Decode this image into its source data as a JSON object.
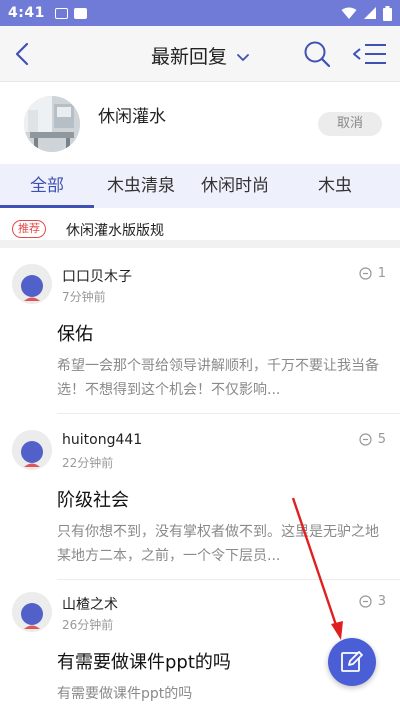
{
  "status_bar": {
    "time": "4:41"
  },
  "header": {
    "title": "最新回复"
  },
  "forum": {
    "name": "休闲灌水",
    "cancel_label": "取消"
  },
  "tabs": [
    {
      "label": "全部",
      "active": true
    },
    {
      "label": "木虫清泉",
      "active": false
    },
    {
      "label": "休闲时尚",
      "active": false
    },
    {
      "label": "木虫",
      "active": false
    }
  ],
  "notice": {
    "badge": "推荐",
    "text": "休闲灌水版版规"
  },
  "posts": [
    {
      "author": "口口贝木子",
      "time": "7分钟前",
      "replies": "1",
      "title": "保佑",
      "excerpt": "希望一会那个哥给领导讲解顺利，千万不要让我当备选！不想得到这个机会！不仅影响..."
    },
    {
      "author": "huitong441",
      "time": "22分钟前",
      "replies": "5",
      "title": "阶级社会",
      "excerpt": "只有你想不到，没有掌权者做不到。这里是无驴之地某地方二本，之前，一个令下层员..."
    },
    {
      "author": "山楂之术",
      "time": "26分钟前",
      "replies": "3",
      "title": "有需要做课件ppt的吗",
      "excerpt": "有需要做课件ppt的吗"
    }
  ],
  "colors": {
    "status_bar": "#6f7bd6",
    "accent": "#3f51b5",
    "fab": "#4a5fd6",
    "avatar": "#5261c9",
    "arrow": "#e02020"
  },
  "icons": {
    "back": "chevron-left-icon",
    "search": "search-icon",
    "menu": "sidebar-menu-icon",
    "fab": "edit-icon"
  }
}
